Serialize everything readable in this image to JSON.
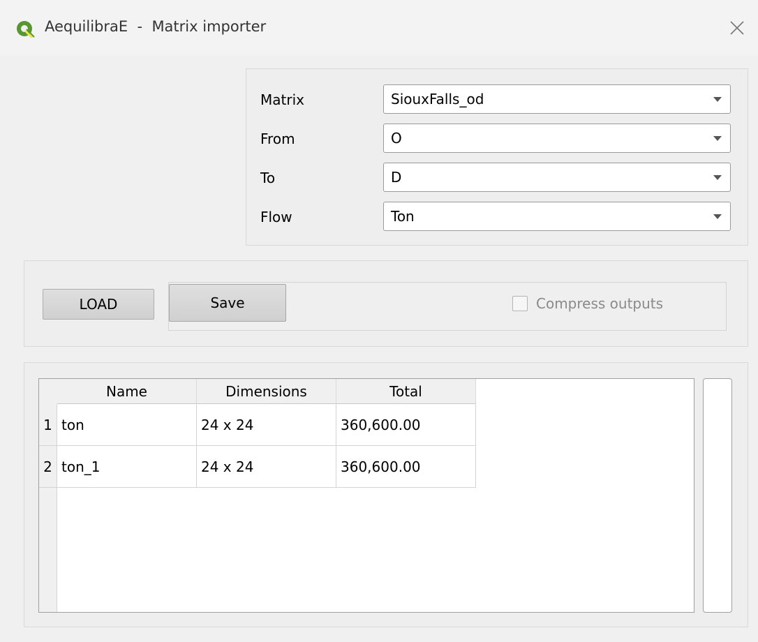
{
  "window": {
    "title": "AequilibraE  -  Matrix importer"
  },
  "form": {
    "matrix_label": "Matrix",
    "matrix_value": "SiouxFalls_od",
    "from_label": "From",
    "from_value": "O",
    "to_label": "To",
    "to_value": "D",
    "flow_label": "Flow",
    "flow_value": "Ton"
  },
  "actions": {
    "load_label": "LOAD",
    "save_label": "Save",
    "compress_label": "Compress outputs",
    "compress_checked": false
  },
  "table": {
    "headers": [
      "Name",
      "Dimensions",
      "Total"
    ],
    "rows": [
      {
        "num": "1",
        "name": "ton",
        "dimensions": "24 x 24",
        "total": "360,600.00"
      },
      {
        "num": "2",
        "name": "ton_1",
        "dimensions": "24 x 24",
        "total": "360,600.00"
      }
    ]
  },
  "colors": {
    "icon_green": "#589632",
    "icon_yellow": "#f0e64a"
  }
}
